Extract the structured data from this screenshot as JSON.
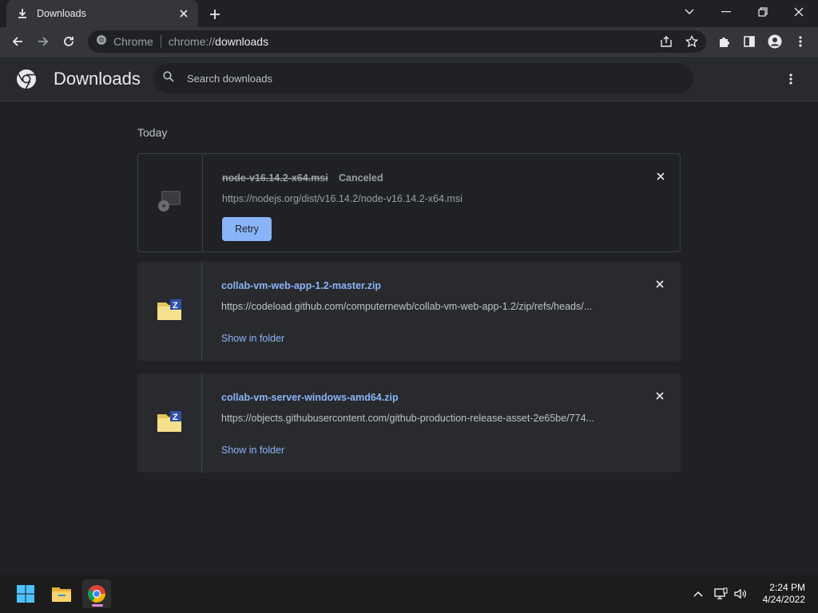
{
  "window": {
    "tab_title": "Downloads",
    "new_tab_icon": "plus-icon"
  },
  "toolbar": {
    "site_label": "Chrome",
    "url_scheme": "chrome://",
    "url_host": "downloads"
  },
  "page": {
    "title": "Downloads",
    "search_placeholder": "Search downloads"
  },
  "downloads": {
    "date_group": "Today",
    "items": [
      {
        "file_name": "node-v16.14.2-x64.msi",
        "status": "Canceled",
        "url": "https://nodejs.org/dist/v16.14.2/node-v16.14.2-x64.msi",
        "action": "Retry"
      },
      {
        "file_name": "collab-vm-web-app-1.2-master.zip",
        "url": "https://codeload.github.com/computernewb/collab-vm-web-app-1.2/zip/refs/heads/...",
        "action": "Show in folder"
      },
      {
        "file_name": "collab-vm-server-windows-amd64.zip",
        "url": "https://objects.githubusercontent.com/github-production-release-asset-2e65be/774...",
        "action": "Show in folder"
      }
    ]
  },
  "taskbar": {
    "time": "2:24 PM",
    "date": "4/24/2022"
  },
  "colors": {
    "accent": "#8ab4f8",
    "background": "#202124",
    "surface": "#292a2d"
  }
}
